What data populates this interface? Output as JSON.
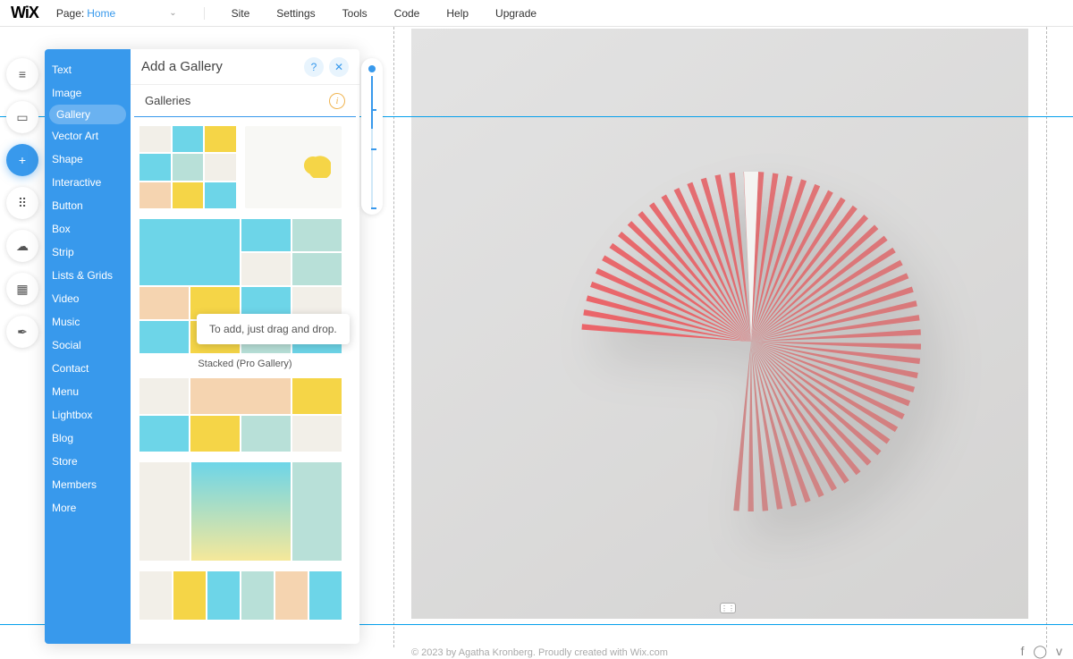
{
  "topbar": {
    "logo": "WiX",
    "page_label": "Page:",
    "page_value": "Home",
    "menu": [
      "Site",
      "Settings",
      "Tools",
      "Code",
      "Help",
      "Upgrade"
    ]
  },
  "dock": [
    {
      "icon": "≡",
      "name": "pages-icon"
    },
    {
      "icon": "▭",
      "name": "background-icon"
    },
    {
      "icon": "+",
      "name": "add-icon",
      "active": true
    },
    {
      "icon": "⠿",
      "name": "apps-icon"
    },
    {
      "icon": "☁",
      "name": "media-icon"
    },
    {
      "icon": "▦",
      "name": "bookings-icon"
    },
    {
      "icon": "✒",
      "name": "blog-icon"
    }
  ],
  "panel": {
    "title": "Add a Gallery",
    "help": "?",
    "close": "✕",
    "section": "Galleries",
    "categories": [
      "Text",
      "Image",
      "Gallery",
      "Vector Art",
      "Shape",
      "Interactive",
      "Button",
      "Box",
      "Strip",
      "Lists & Grids",
      "Video",
      "Music",
      "Social",
      "Contact",
      "Menu",
      "Lightbox",
      "Blog",
      "Store",
      "Members",
      "More"
    ],
    "selected_category": "Gallery",
    "tooltip": "To add, just drag and drop.",
    "caption1": "Stacked (Pro Gallery)"
  },
  "footer": {
    "text": "© 2023 by Agatha Kronberg. Proudly created with Wix.com"
  }
}
